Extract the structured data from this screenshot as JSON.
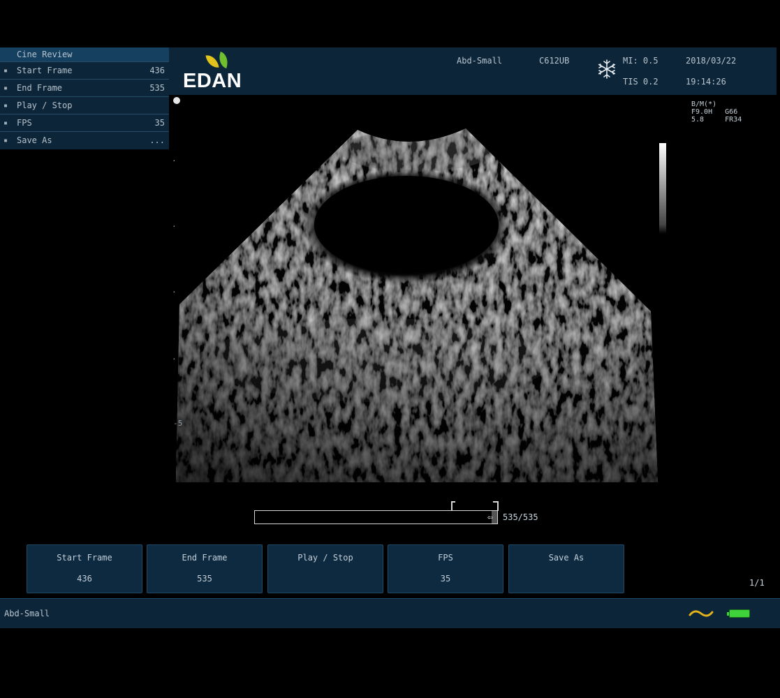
{
  "header": {
    "brand": "EDAN",
    "preset": "Abd-Small",
    "probe": "C612UB",
    "mi": "MI: 0.5",
    "tis": "TIS 0.2",
    "date": "2018/03/22",
    "time": "19:14:26",
    "freeze_icon": "snowflake-icon"
  },
  "side_menu": {
    "title": "Cine Review",
    "items": [
      {
        "label": "Start Frame",
        "value": "436"
      },
      {
        "label": "End Frame",
        "value": "535"
      },
      {
        "label": "Play / Stop",
        "value": ""
      },
      {
        "label": "FPS",
        "value": "35"
      },
      {
        "label": "Save As",
        "value": "..."
      }
    ]
  },
  "image": {
    "params": "B/M(*)\nF9.0H   G66\n5.8     FR34",
    "depth_marks": [
      "-5"
    ]
  },
  "cine": {
    "frame_counter": "535/535",
    "progress": 1.0
  },
  "softkeys": [
    {
      "label": "Start Frame",
      "value": "436"
    },
    {
      "label": "End Frame",
      "value": "535"
    },
    {
      "label": "Play / Stop",
      "value": ""
    },
    {
      "label": "FPS",
      "value": "35"
    },
    {
      "label": "Save As",
      "value": ""
    }
  ],
  "page_indicator": "1/1",
  "status": {
    "text": "Abd-Small",
    "icons": [
      "wave-icon",
      "battery-icon"
    ],
    "battery_color": "#3fd23a"
  },
  "colors": {
    "panel": "#0c2538",
    "accent": "#16405f"
  }
}
